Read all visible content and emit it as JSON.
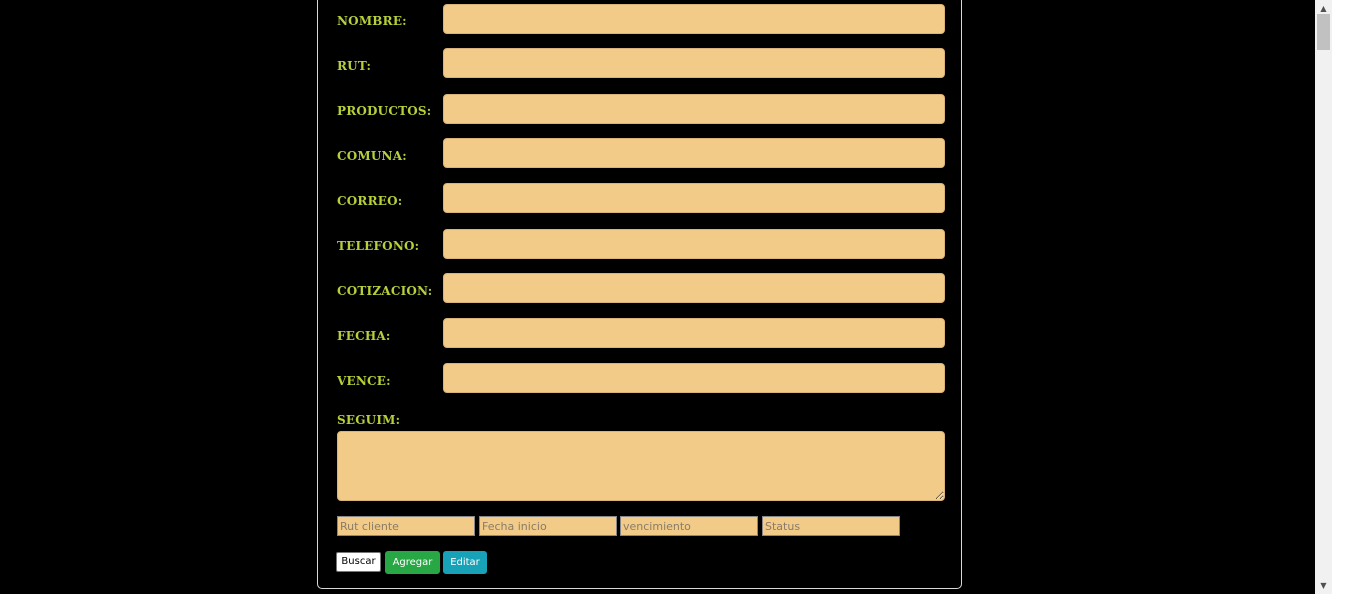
{
  "form": {
    "fields": [
      {
        "label": "NOMBRE:",
        "value": ""
      },
      {
        "label": "RUT:",
        "value": ""
      },
      {
        "label": "PRODUCTOS:",
        "value": ""
      },
      {
        "label": "COMUNA:",
        "value": ""
      },
      {
        "label": "CORREO:",
        "value": ""
      },
      {
        "label": "TELEFONO:",
        "value": ""
      },
      {
        "label": "COTIZACION:",
        "value": ""
      },
      {
        "label": "FECHA:",
        "value": ""
      },
      {
        "label": "VENCE:",
        "value": ""
      }
    ],
    "seguim_label": "SEGUIM:",
    "seguim_value": ""
  },
  "search": {
    "placeholders": {
      "rut_cliente": "Rut cliente",
      "fecha_inicio": "Fecha inicio",
      "vencimiento": "vencimiento",
      "status": "Status"
    }
  },
  "buttons": {
    "buscar": "Buscar",
    "agregar": "Agregar",
    "editar": "Editar"
  },
  "icons": {
    "scroll_up": "chevron-up-icon",
    "scroll_down": "chevron-down-icon"
  },
  "colors": {
    "label": "#b7cf3a",
    "input_bg": "#f1cb87",
    "agregar": "#28a745",
    "editar": "#17a2b8"
  }
}
